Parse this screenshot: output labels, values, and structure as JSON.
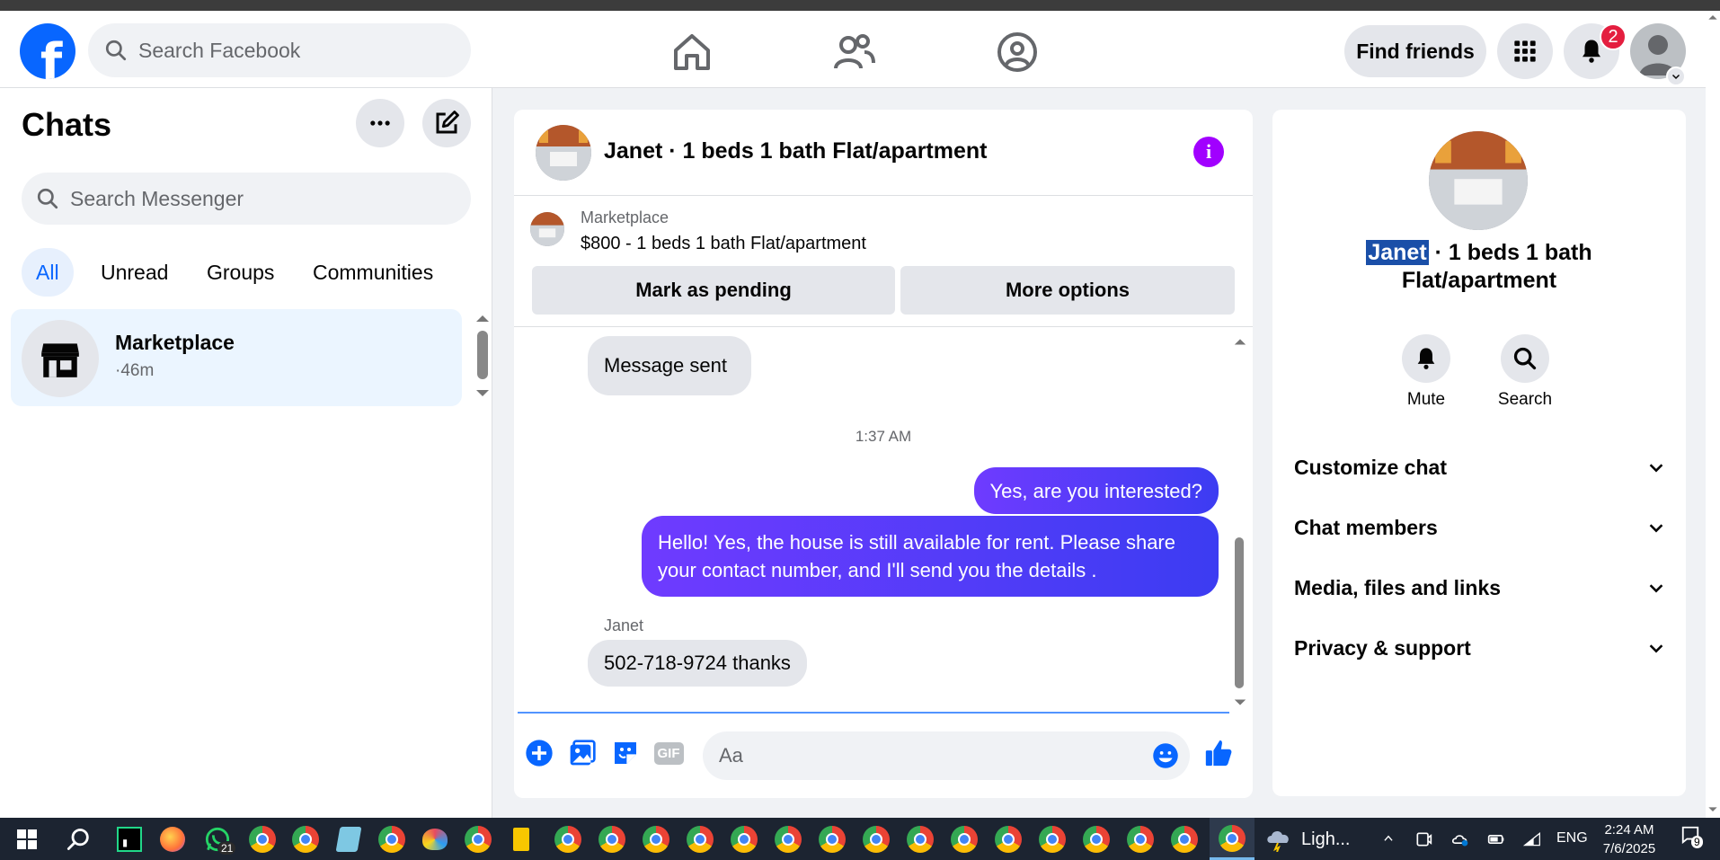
{
  "header": {
    "logo_letter": "f",
    "search_placeholder": "Search Facebook",
    "find_friends_label": "Find friends",
    "notification_count": "2"
  },
  "chats": {
    "title": "Chats",
    "search_placeholder": "Search Messenger",
    "filters": [
      "All",
      "Unread",
      "Groups",
      "Communities"
    ],
    "conversations": [
      {
        "name": "Marketplace",
        "time": "·46m"
      }
    ]
  },
  "conversation": {
    "title": "Janet · 1 beds 1 bath Flat/apartment",
    "info_glyph": "i",
    "marketplace": {
      "label": "Marketplace",
      "listing": "$800 - 1 beds 1 bath Flat/apartment",
      "mark_pending_label": "Mark as pending",
      "more_options_label": "More options"
    },
    "messages": {
      "sent_notice": "Message sent",
      "time_divider": "1:37 AM",
      "outgoing_1": "Yes, are you interested?",
      "outgoing_2": "Hello! Yes, the house is still available for rent. Please share your contact number, and I'll send you the details .",
      "sender_name": "Janet",
      "incoming_1": "502-718-9724 thanks"
    },
    "composer": {
      "placeholder": "Aa",
      "gif_label": "GIF"
    }
  },
  "info_panel": {
    "title_highlight": "Janet",
    "title_rest": " · 1 beds 1 bath Flat/apartment",
    "mute_label": "Mute",
    "search_label": "Search",
    "sections": [
      "Customize chat",
      "Chat members",
      "Media, files and links",
      "Privacy & support"
    ]
  },
  "taskbar": {
    "whatsapp_badge": "21",
    "weather": "Ligh...",
    "lang": "ENG",
    "time": "2:24 AM",
    "date": "7/6/2025",
    "notification_count": "9"
  },
  "colors": {
    "brand": "#0866ff",
    "outgoing_bubble": "#5b3bff",
    "info_button": "#a100ff",
    "badge": "#e41e3f"
  }
}
